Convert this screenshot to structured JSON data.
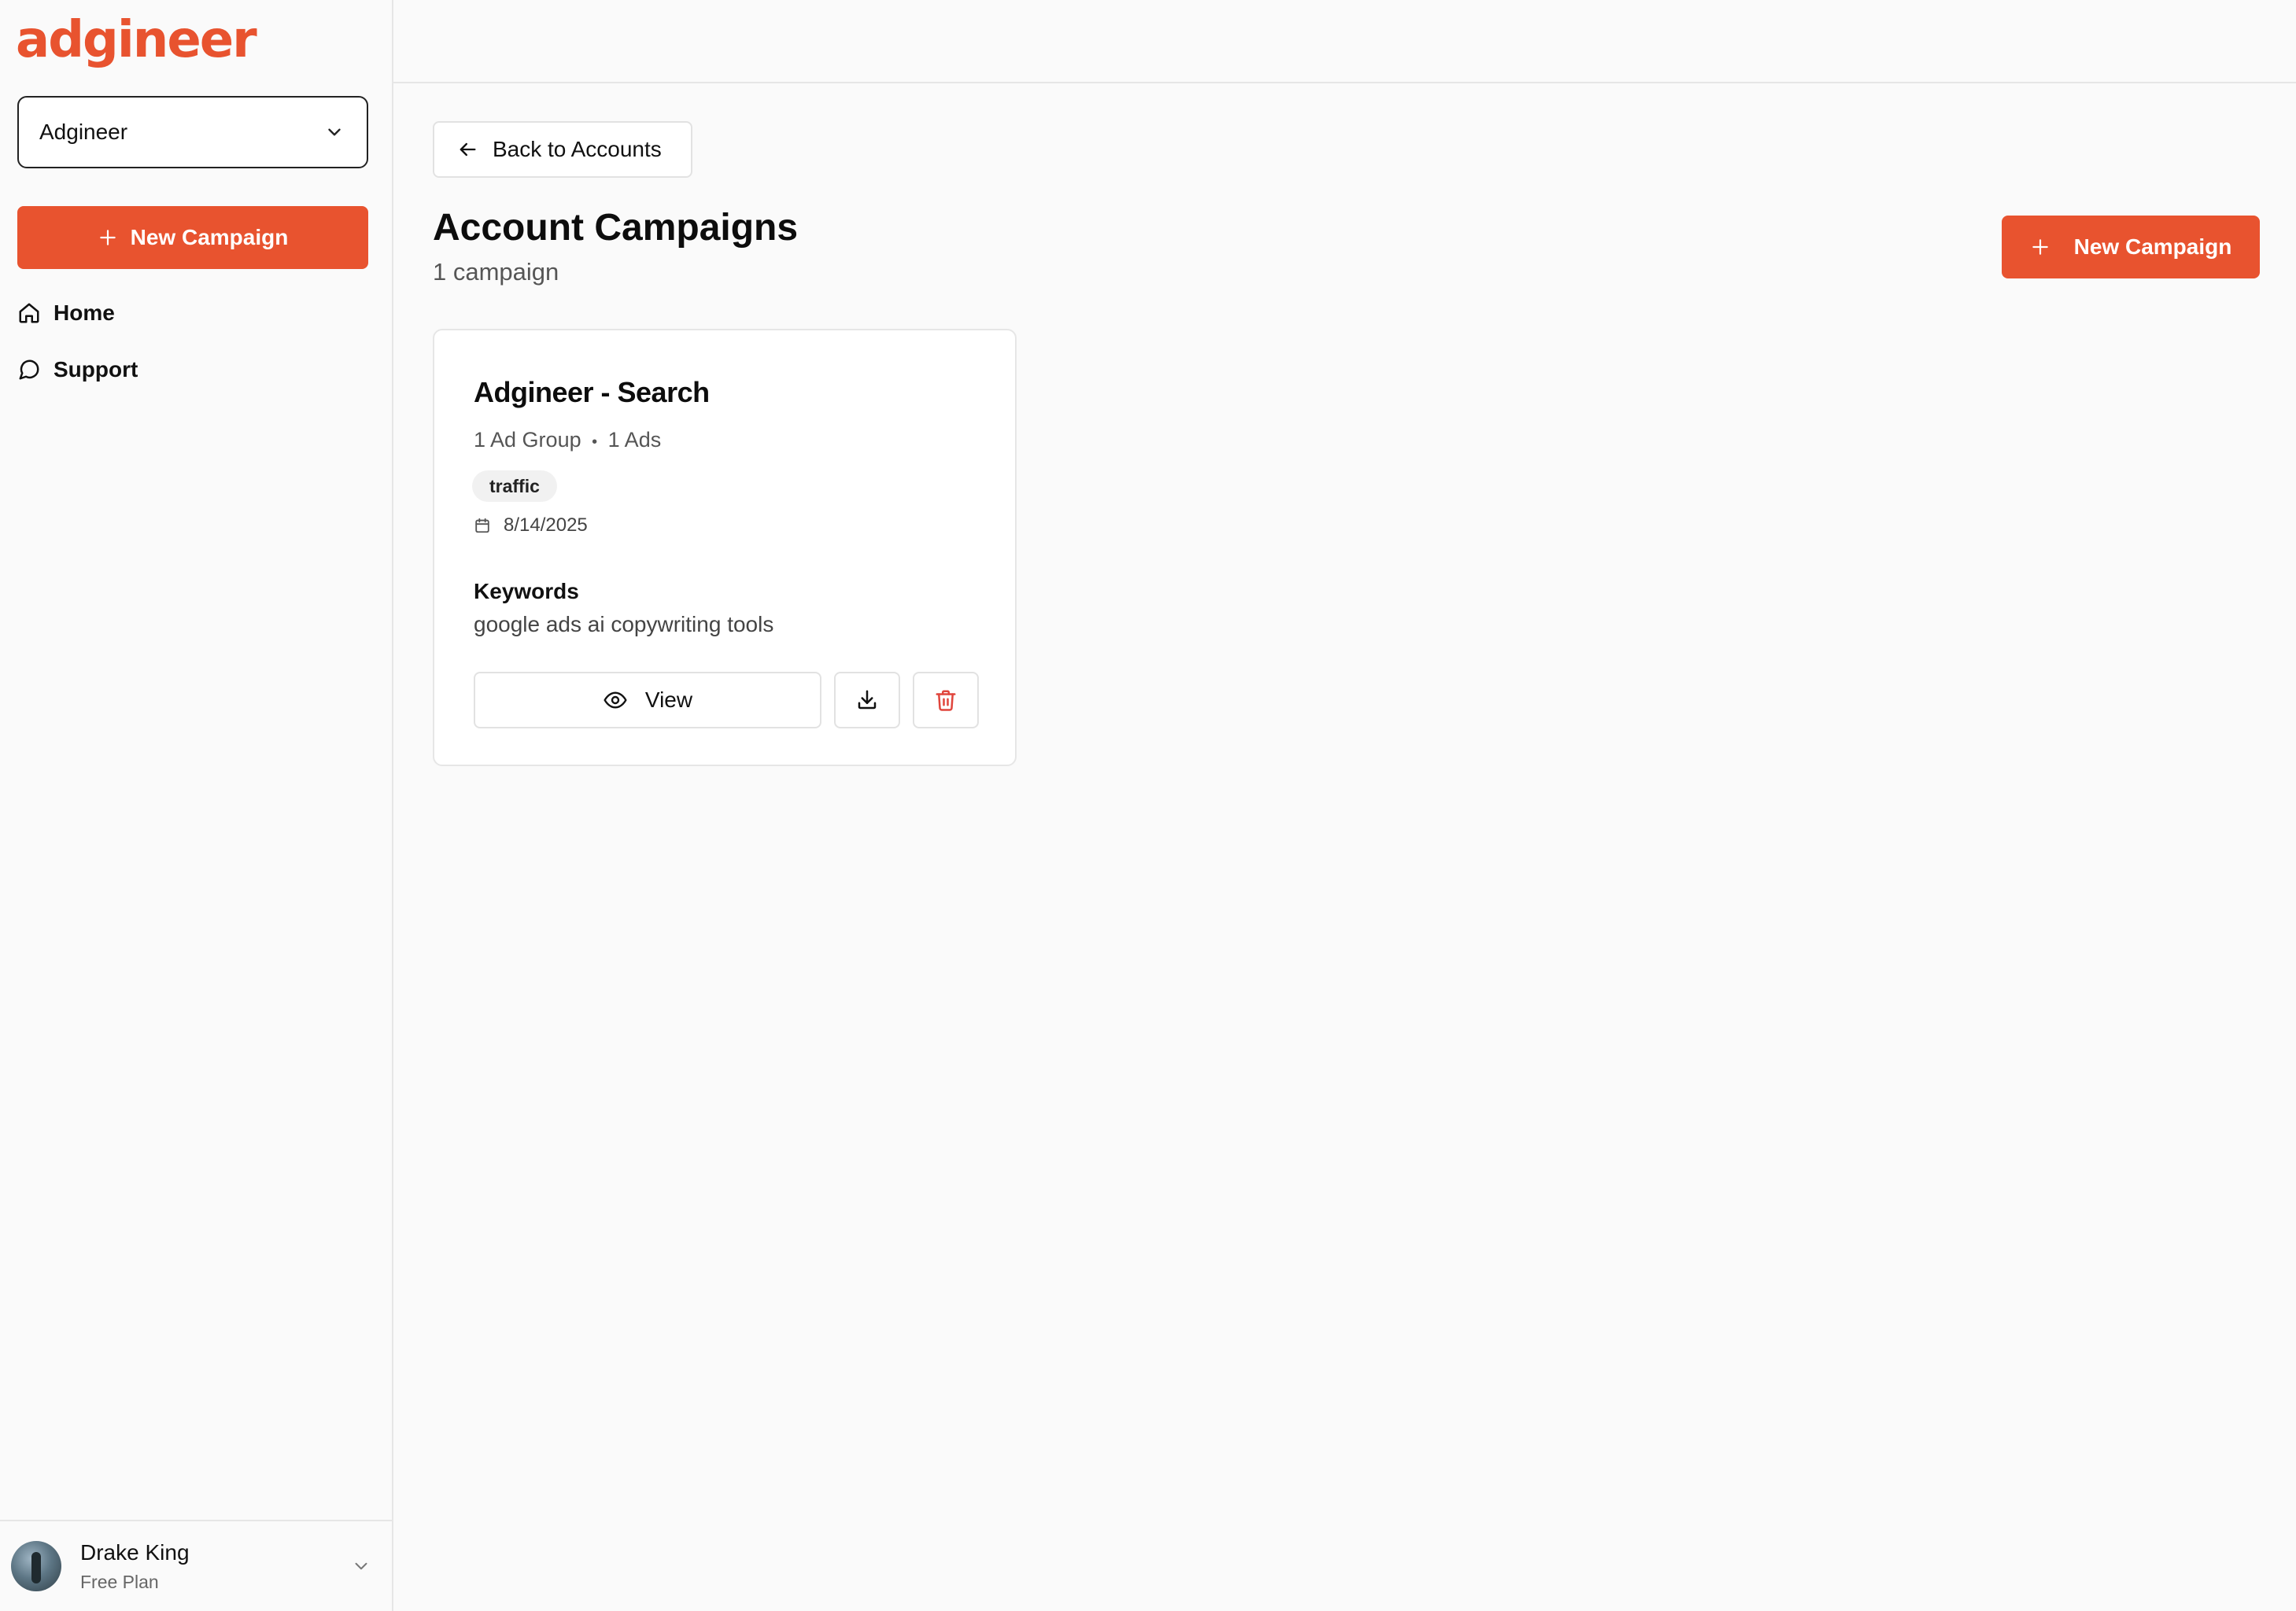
{
  "brand": {
    "logo_text": "adgineer",
    "accent_color": "#e8532f"
  },
  "sidebar": {
    "account_select": {
      "value": "Adgineer",
      "icon": "chevron-down-icon"
    },
    "new_campaign_label": "New Campaign",
    "nav": [
      {
        "label": "Home",
        "icon": "home-icon"
      },
      {
        "label": "Support",
        "icon": "message-circle-icon"
      }
    ],
    "user": {
      "name": "Drake King",
      "plan": "Free Plan"
    }
  },
  "main": {
    "back_label": "Back to Accounts",
    "title": "Account Campaigns",
    "subtitle": "1 campaign",
    "new_campaign_label": "New Campaign",
    "campaigns": [
      {
        "name": "Adgineer - Search",
        "ad_groups": "1 Ad Group",
        "separator": "•",
        "ads": "1 Ads",
        "tag": "traffic",
        "date": "8/14/2025",
        "keywords_label": "Keywords",
        "keywords": "google ads ai copywriting tools",
        "view_label": "View"
      }
    ]
  }
}
